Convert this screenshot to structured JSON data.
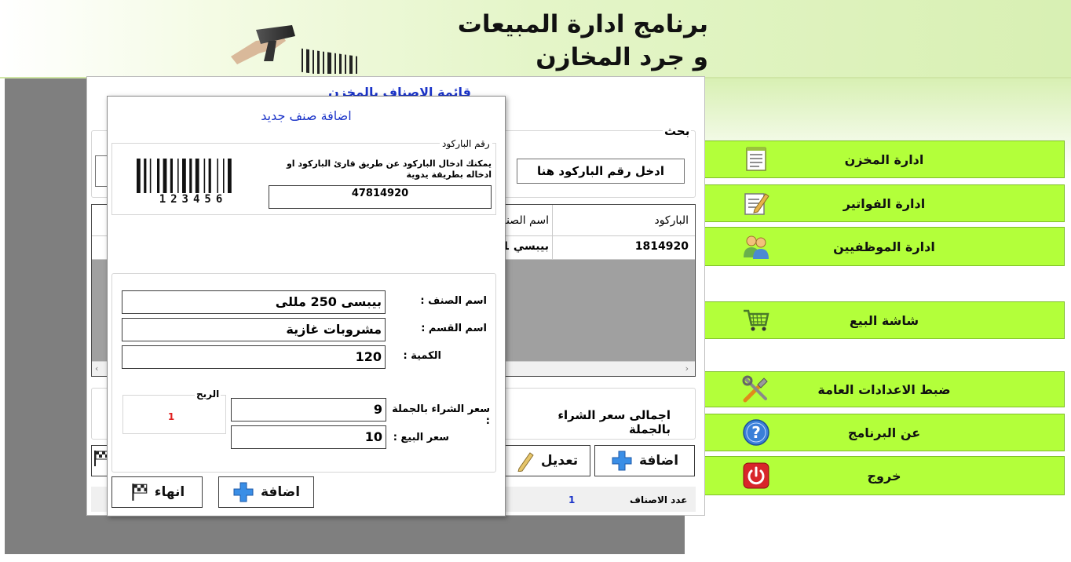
{
  "header": {
    "title_line1": "برنامج ادارة المبيعات",
    "title_line2": "و جرد المخازن"
  },
  "side_menu": {
    "items": [
      {
        "label": "ادارة المخزن",
        "icon": "notepad-icon"
      },
      {
        "label": "ادارة الفواتير",
        "icon": "edit-document-icon"
      },
      {
        "label": "ادارة الموظفيين",
        "icon": "users-icon"
      },
      {
        "label": "شاشة البيع",
        "icon": "shopping-cart-icon"
      },
      {
        "label": "ضبط الاعدادات العامة",
        "icon": "tools-icon"
      },
      {
        "label": "عن البرنامج",
        "icon": "help-icon"
      },
      {
        "label": "خروج",
        "icon": "power-icon"
      }
    ]
  },
  "list_window": {
    "title": "قائمة الاصناف بالمخزن",
    "search_label": "بحث",
    "search_placeholder": "ادخل رقم الباركود هنا",
    "search_red_char": "أ",
    "grid": {
      "columns": [
        "الباركود",
        "اسم الصنف"
      ],
      "rows": [
        [
          "1814920",
          "بيبسي 1 لتر"
        ]
      ]
    },
    "total_buy_label": "اجمالى سعر الشراء بالجملة",
    "add_button": "اضافة",
    "edit_button": "تعديل",
    "item_count_label": "عدد الاصناف",
    "item_count_value": "1"
  },
  "dialog": {
    "title": "اضافة صنف جديد",
    "barcode_legend": "رقم الباركود",
    "barcode_hint": "يمكنك ادخال الباركود عن طريق قارئ الباركود او ادخاله بطريقة يدوية",
    "barcode_value": "47814920",
    "barcode_image_digits": "123456",
    "fields": {
      "name_label": "اسم الصنف :",
      "name_value": "بيبسى 250 مللى",
      "category_label": "اسم القسم :",
      "category_value": "مشروبات غازية",
      "quantity_label": "الكمية :",
      "quantity_value": "120",
      "wholesale_label": "سعر الشراء بالجملة :",
      "wholesale_value": "9",
      "sale_label": "سعر البيع :",
      "sale_value": "10",
      "profit_legend": "الربح",
      "profit_value": "1"
    },
    "add_button": "اضافة",
    "finish_button": "انهاء"
  },
  "colors": {
    "menu_bg": "#b3ff3a",
    "title_blue": "#1a33c8",
    "accent_red": "#e02020",
    "workspace_grey": "#7f7f7f"
  }
}
